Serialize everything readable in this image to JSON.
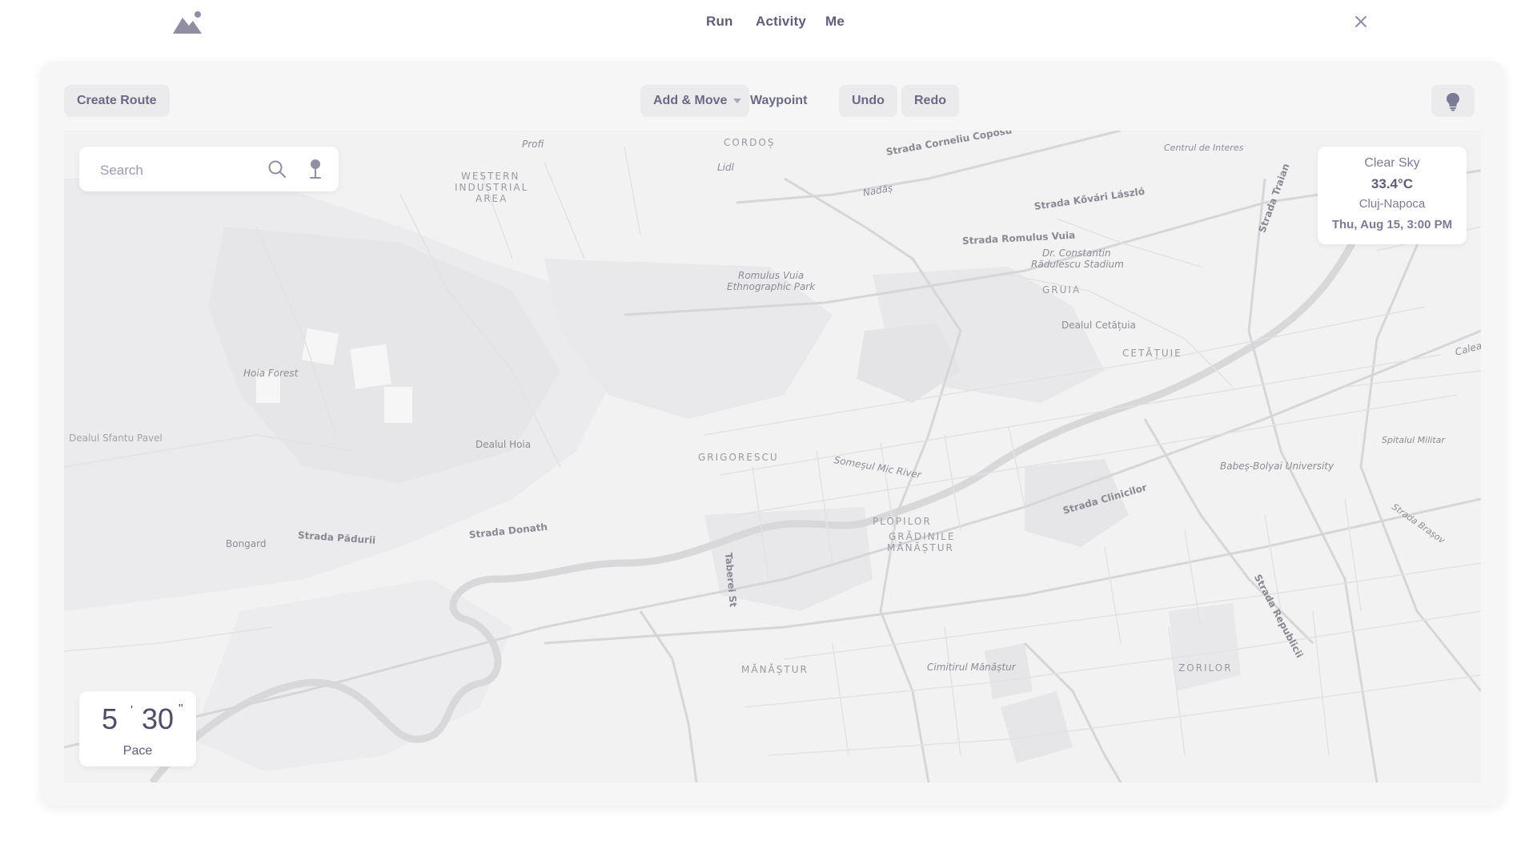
{
  "nav": {
    "links": [
      "Run",
      "Activity",
      "Me"
    ]
  },
  "toolbar": {
    "create_route": "Create Route",
    "add_move": "Add & Move",
    "waypoint": "Waypoint",
    "undo": "Undo",
    "redo": "Redo"
  },
  "search": {
    "placeholder": "Search"
  },
  "weather": {
    "condition": "Clear Sky",
    "temperature": "33.4°C",
    "city": "Cluj-Napoca",
    "datetime": "Thu, Aug 15, 3:00 PM"
  },
  "pace": {
    "minutes": "5",
    "seconds": "30",
    "label": "Pace"
  },
  "map": {
    "labels": {
      "profi": "Profi",
      "cordos": "CORDOȘ",
      "lidl": "Lidl",
      "strada_coposu": "Strada Corneliu Coposu",
      "centrul": "Centrul de Interes",
      "western": "WESTERN",
      "industrial": "INDUSTRIAL",
      "area": "AREA",
      "nadas": "Nadăș",
      "kovari": "Strada Kővári László",
      "traian": "Strada Traian",
      "romulus_vuia": "Strada Romulus Vuia",
      "dr_constantin": "Dr. Constantin",
      "radulescu": "Rădulescu Stadium",
      "park1": "Romulus Vuia",
      "park2": "Ethnographic Park",
      "gruia": "GRUIA",
      "cetatuia": "Dealul Cetățuia",
      "cetatuie": "CETĂȚUIE",
      "hoia_forest": "Hoia Forest",
      "calea": "Calea",
      "sfantu_pavel": "Dealul Sfantu Pavel",
      "dealul_hoia": "Dealul Hoia",
      "grigorescu": "GRIGORESCU",
      "somesul": "Someșul Mic River",
      "spitalul": "Spitalul Militar",
      "babes": "Babeș-Bolyai University",
      "clinicilor": "Strada Clinicilor",
      "bongard": "Bongard",
      "paduri": "Strada Pădurii",
      "donath": "Strada Donath",
      "plopilor": "PLOPILOR",
      "gradinile": "GRĂDINILE",
      "manastur": "MĂNĂȘTUR",
      "taberei": "Taberei St",
      "brasov": "Strada Brașov",
      "republicii": "Strada Republicii",
      "manastur2": "MĂNĂȘTUR",
      "cimitirul": "Cimitirul Mănăștur",
      "zorilor": "ZORILOR"
    }
  },
  "icons": {
    "logo": "mountain-logo-icon",
    "close": "close-icon",
    "search": "search-icon",
    "pin": "location-pin-icon",
    "bulb": "lightbulb-icon"
  },
  "colors": {
    "accent": "#5f5d78",
    "button_bg": "#ebebee",
    "card_bg": "#f6f6f7",
    "map_bg": "#f2f2f3"
  }
}
